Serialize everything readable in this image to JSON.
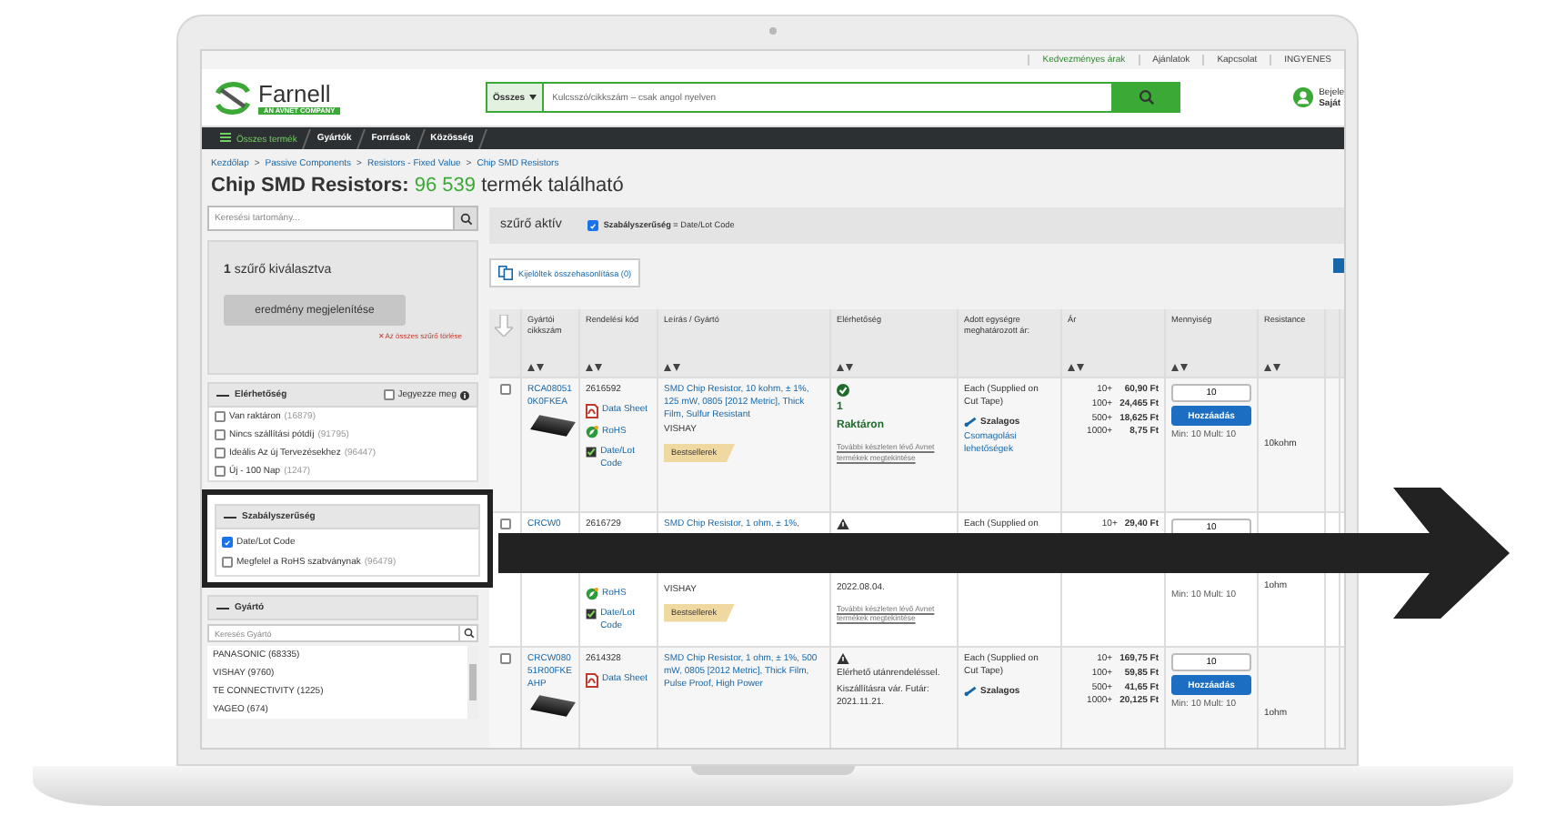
{
  "top_links": [
    {
      "label": "Kedvezményes árak",
      "kind": "promo"
    },
    {
      "label": "Ajánlatok",
      "kind": "plain"
    },
    {
      "label": "Kapcsolat",
      "kind": "plain"
    },
    {
      "label": "INGYENES",
      "kind": "plain"
    }
  ],
  "logo": {
    "name": "Farnell",
    "tagline": "AN AVNET COMPANY"
  },
  "search": {
    "scope": "Összes",
    "placeholder": "Kulcsszó/cikkszám – csak angol nyelven"
  },
  "account": {
    "line_1": "Bejele",
    "line_2": "Saját"
  },
  "nav": [
    {
      "label": "Összes termék",
      "selected": true
    },
    {
      "label": "Gyártók",
      "selected": false
    },
    {
      "label": "Források",
      "selected": false
    },
    {
      "label": "Közösség",
      "selected": false
    }
  ],
  "breadcrumb": {
    "separator": ">",
    "items": [
      "Kezdőlap",
      "Passive Components",
      "Resistors - Fixed Value",
      "Chip SMD Resistors"
    ]
  },
  "heading": {
    "title": "Chip SMD Resistors:",
    "count": "96 539",
    "suffix": "termék található"
  },
  "sidebar": {
    "search_placeholder": "Keresési tartomány...",
    "selection": {
      "count": "1",
      "label": "szűrő kiválasztva",
      "button": "eredmény megjelenítése",
      "clear": "✕ Az összes szűrő törlése"
    },
    "groups": [
      {
        "kind": "checkboxes",
        "title": "Elérhetőség",
        "highlighted": false,
        "remember": {
          "label": "Jegyezze meg",
          "checked": false
        },
        "options": [
          {
            "label": "Van raktáron",
            "count": "(16879)",
            "checked": false
          },
          {
            "label": "Nincs szállítási pótdíj",
            "count": "(91795)",
            "checked": false
          },
          {
            "label": "Ideális Az új Tervezésekhez",
            "count": "(96447)",
            "checked": false
          },
          {
            "label": "Új - 100 Nap",
            "count": "(1247)",
            "checked": false
          }
        ]
      },
      {
        "kind": "checkboxes",
        "title": "Szabályszerűség",
        "highlighted": true,
        "options": [
          {
            "label": "Date/Lot Code",
            "checked": true
          },
          {
            "label": "Megfelel a RoHS szabványnak",
            "count": "(96479)",
            "checked": false
          }
        ]
      },
      {
        "kind": "search_list",
        "title": "Gyártó",
        "highlighted": false,
        "search_placeholder": "Keresés Gyártó",
        "items": [
          "PANASONIC (68335)",
          "VISHAY (9760)",
          "TE CONNECTIVITY (1225)",
          "YAGEO (674)"
        ]
      }
    ]
  },
  "active_filters": {
    "label": "szűrő aktív",
    "filters": [
      {
        "text": "**Szabályszerűség** = Date/Lot Code",
        "checked": true
      }
    ]
  },
  "compare_button": "Kijelöltek összehasonlítása (0)",
  "table": {
    "columns": [
      "Gyártói cikkszám",
      "Rendelési kód",
      "Leírás / Gyártó",
      "Elérhetőség",
      "Adott egységre meghatározott ár:",
      "Ár",
      "Mennyiség",
      "Resistance"
    ],
    "rows": [
      {
        "selected": false,
        "covered": false,
        "part": "RCA080510K0FKEA",
        "photo": true,
        "order_code": "2616592",
        "docs": [
          {
            "kind": "datasheet",
            "label": "Data Sheet"
          },
          {
            "kind": "rohs",
            "label": "RoHS"
          },
          {
            "kind": "datelot",
            "label": "Date/Lot Code"
          }
        ],
        "description": "SMD Chip Resistor, 10 kohm, ± 1%, 125 mW, 0805 [2012 Metric], Thick Film, Sulfur Resistant",
        "maker": "VISHAY",
        "badge": "Bestsellerek",
        "availability": {
          "kind": "in_stock",
          "lines": [
            {
              "kind": "stock",
              "text": "1"
            },
            {
              "kind": "stock",
              "text": "Raktáron"
            },
            {
              "kind": "note",
              "text": "További készleten lévő Avnet termékek megtekintése"
            }
          ]
        },
        "unit": "Each (Supplied on Cut Tape)",
        "packaging": "Szalagos",
        "packaging_link": "Csomagolási lehetőségek",
        "prices": [
          {
            "qty": "10+",
            "price": "60,90 Ft"
          },
          {
            "qty": "100+",
            "price": "24,465 Ft"
          },
          {
            "qty": "500+",
            "price": "18,625 Ft"
          },
          {
            "qty": "1000+",
            "price": "8,75 Ft"
          }
        ],
        "quantity": "10",
        "add_button": "Hozzáadás",
        "min_mult": "Min: 10 Mult: 10",
        "resistance": "10kohm"
      },
      {
        "selected": false,
        "covered": true,
        "part": "CRCW0",
        "photo": false,
        "order_code": "2616729",
        "docs": [
          {
            "kind": "rohs",
            "label": "RoHS"
          },
          {
            "kind": "datelot",
            "label": "Date/Lot Code"
          }
        ],
        "description": "SMD Chip Resistor, 1 ohm, ± 1%,",
        "maker": "VISHAY",
        "badge": "Bestsellerek",
        "availability": {
          "kind": "backorder",
          "lines": [
            {
              "kind": "plain",
              "text": "2022.08.04."
            },
            {
              "kind": "note",
              "text": "További készleten lévő Avnet termékek megtekintése"
            }
          ]
        },
        "unit": "Each (Supplied on",
        "prices": [
          {
            "qty": "10+",
            "price": "29,40 Ft"
          }
        ],
        "quantity": "10",
        "min_mult": "Min: 10 Mult: 10",
        "resistance": "1ohm"
      },
      {
        "selected": false,
        "covered": false,
        "part": "CRCW08051R00FKEAHP",
        "photo": true,
        "order_code": "2614328",
        "docs": [
          {
            "kind": "datasheet",
            "label": "Data Sheet"
          }
        ],
        "description": "SMD Chip Resistor, 1 ohm, ± 1%, 500 mW, 0805 [2012 Metric], Thick Film, Pulse Proof, High Power",
        "availability": {
          "kind": "backorder",
          "lines": [
            {
              "kind": "plain",
              "text": "Elérhető utánrendeléssel."
            },
            {
              "kind": "plain",
              "text": "Kiszállításra vár. Futár: 2021.11.21."
            }
          ]
        },
        "unit": "Each (Supplied on Cut Tape)",
        "packaging": "Szalagos",
        "prices": [
          {
            "qty": "10+",
            "price": "169,75 Ft"
          },
          {
            "qty": "100+",
            "price": "59,85 Ft"
          },
          {
            "qty": "500+",
            "price": "41,65 Ft"
          },
          {
            "qty": "1000+",
            "price": "20,125 Ft"
          }
        ],
        "quantity": "10",
        "add_button": "Hozzáadás",
        "min_mult": "Min: 10 Mult: 10",
        "resistance": "1ohm"
      }
    ]
  }
}
